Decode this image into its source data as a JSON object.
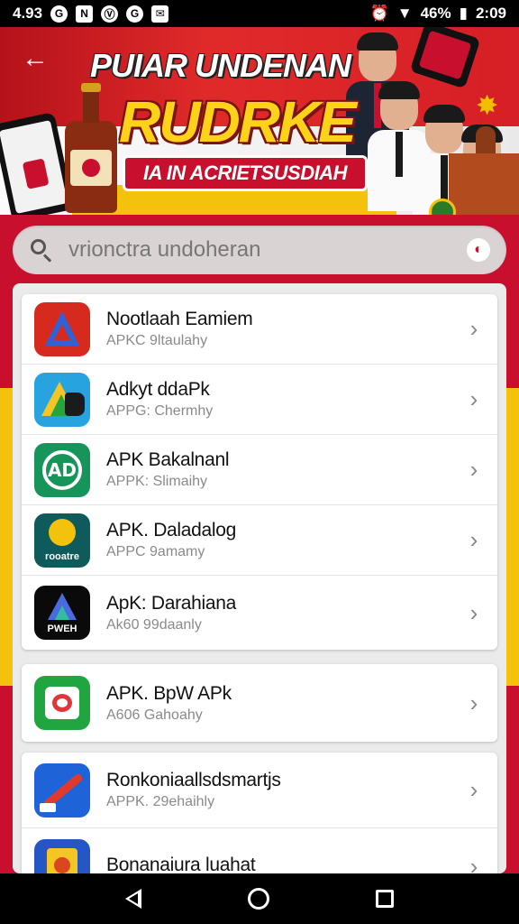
{
  "status_bar": {
    "left_text": "4.93",
    "left_icons": [
      "G",
      "N",
      "Ⓥ",
      "G",
      "✉"
    ],
    "battery": "46%",
    "time": "2:09"
  },
  "banner": {
    "title_line1": "PUIAR UNDENAN",
    "title_line2": "RUDRKE",
    "subtitle": "IA IN ACRIETSUSDIAH"
  },
  "search": {
    "value": "vrionctra undoheran",
    "placeholder": "vrionctra undoheran"
  },
  "apps": [
    {
      "name": "Nootlaah Eamiem",
      "sub": "APKC 9ltaulahy"
    },
    {
      "name": "Adkyt ddaPk",
      "sub": "APPG: Chermhy"
    },
    {
      "name": "APK Bakalnanl",
      "sub": "APPK: Slimaihy"
    },
    {
      "name": "APK. Daladalog",
      "sub": "APPC 9amamy"
    },
    {
      "name": "ApK: Darahiana",
      "sub": "Ak60 99daanly"
    },
    {
      "name": "APK. BpW APk",
      "sub": "A606 Gahoahy"
    },
    {
      "name": "Ronkoniaallsdsmartjs",
      "sub": "APPK. 29ehaihly"
    },
    {
      "name": "Bonanaiura luahat",
      "sub": ""
    }
  ],
  "icon_labels": {
    "app3": "AD",
    "app4": "rooatre",
    "app5": "PWEH"
  },
  "colors": {
    "brand_red": "#c8102e",
    "accent_yellow": "#f4c20d"
  }
}
